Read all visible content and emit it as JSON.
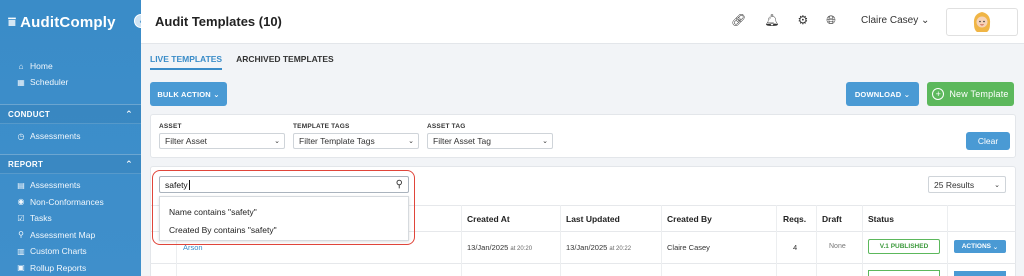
{
  "app": {
    "name": "AuditComply"
  },
  "sidebar": {
    "top_items": [
      {
        "label": "Home",
        "icon": "home-icon"
      },
      {
        "label": "Scheduler",
        "icon": "calendar-icon"
      }
    ],
    "sections": [
      {
        "title": "CONDUCT",
        "items": [
          {
            "label": "Assessments",
            "icon": "clock-icon"
          }
        ]
      },
      {
        "title": "REPORT",
        "items": [
          {
            "label": "Assessments",
            "icon": "list-icon"
          },
          {
            "label": "Non-Conformances",
            "icon": "alert-icon"
          },
          {
            "label": "Tasks",
            "icon": "tasks-icon"
          },
          {
            "label": "Assessment Map",
            "icon": "map-pin-icon"
          },
          {
            "label": "Custom Charts",
            "icon": "chart-icon"
          },
          {
            "label": "Rollup Reports",
            "icon": "report-icon"
          }
        ]
      }
    ]
  },
  "header": {
    "title": "Audit Templates (10)",
    "user_name": "Claire Casey"
  },
  "tabs": [
    {
      "label": "LIVE TEMPLATES"
    },
    {
      "label": "ARCHIVED TEMPLATES"
    }
  ],
  "toolbar": {
    "bulk_action": "BULK ACTION",
    "download": "DOWNLOAD",
    "new_template": "New Template"
  },
  "filters": {
    "asset": {
      "label": "ASSET",
      "value": "Filter Asset"
    },
    "template_tags": {
      "label": "TEMPLATE TAGS",
      "value": "Filter Template Tags"
    },
    "asset_tag": {
      "label": "ASSET TAG",
      "value": "Filter Asset Tag"
    },
    "clear": "Clear"
  },
  "search": {
    "value": "safety",
    "suggestions": [
      "Name contains \"safety\"",
      "Created By contains \"safety\""
    ]
  },
  "results_per_page": "25 Results",
  "table": {
    "columns": [
      "Created At",
      "Last Updated",
      "Created By",
      "Reqs.",
      "Draft",
      "Status"
    ],
    "rows": [
      {
        "name": "Arson",
        "created_at": "13/Jan/2025",
        "created_time": "at 20:20",
        "last_updated": "13/Jan/2025",
        "updated_time": "at 20:22",
        "created_by": "Claire Casey",
        "reqs": "4",
        "draft": "None",
        "status": "V.1 PUBLISHED",
        "actions": "ACTIONS"
      }
    ]
  },
  "colors": {
    "brand": "#3a8cc8",
    "success": "#5cb85c",
    "highlight": "#e0453a"
  }
}
